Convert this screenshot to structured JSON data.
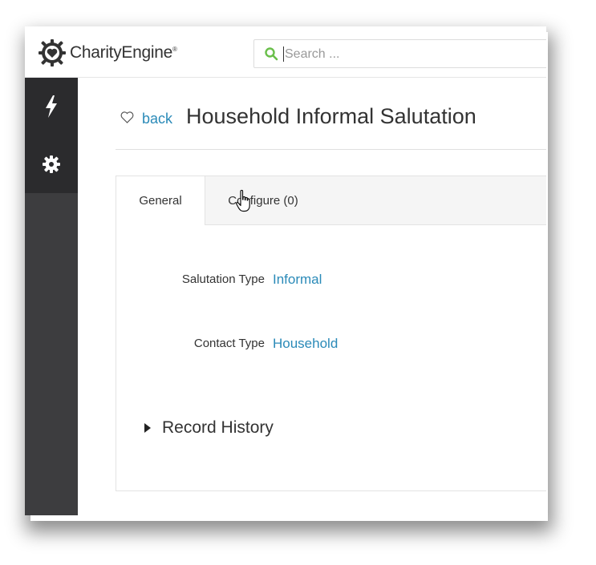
{
  "header": {
    "logo_text": "CharityEngine",
    "logo_mark": "®",
    "search": {
      "placeholder": "Search ..."
    }
  },
  "sidebar": {
    "items": [
      {
        "icon": "lightning-icon"
      },
      {
        "icon": "gear-icon"
      }
    ]
  },
  "page": {
    "back_label": "back",
    "title": "Household Informal Salutation"
  },
  "tabs": [
    {
      "label": "General",
      "active": true
    },
    {
      "label": "Configure (0)",
      "active": false
    }
  ],
  "fields": [
    {
      "label": "Salutation Type",
      "value": "Informal"
    },
    {
      "label": "Contact Type",
      "value": "Household"
    }
  ],
  "record_history": {
    "label": "Record History"
  },
  "colors": {
    "link": "#2a8ab8",
    "sidebar": "#3d3d3f",
    "sidebar_active": "#2b2b2d",
    "search_icon": "#6abf4b"
  }
}
